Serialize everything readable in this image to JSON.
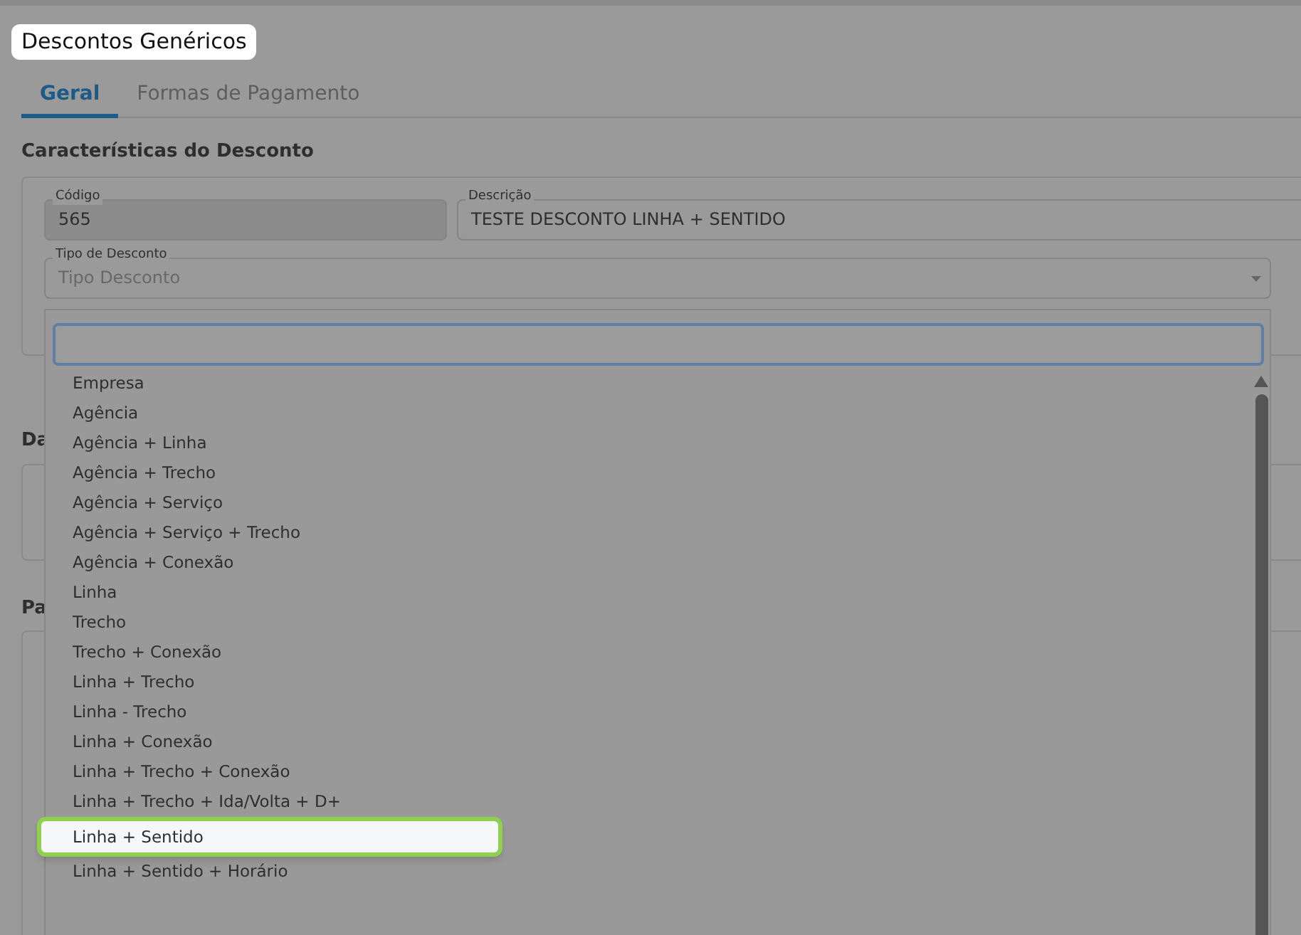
{
  "page": {
    "title": "Descontos Genéricos"
  },
  "tabs": [
    {
      "label": "Geral",
      "selected": true
    },
    {
      "label": "Formas de Pagamento",
      "selected": false
    }
  ],
  "sections": [
    {
      "heading": "Características do Desconto"
    },
    {
      "heading": "Da"
    },
    {
      "heading": "Pa"
    }
  ],
  "fields": [
    {
      "label": "Código",
      "value": "565",
      "disabled": true
    },
    {
      "label": "Descrição",
      "value": "TESTE DESCONTO LINHA + SENTIDO",
      "disabled": false
    }
  ],
  "dropdown": {
    "label": "Tipo de Desconto",
    "placeholder": "Tipo Desconto",
    "expanded": true,
    "options": [
      {
        "label": "Empresa",
        "selected": false
      },
      {
        "label": "Agência",
        "selected": false
      },
      {
        "label": "Agência + Linha",
        "selected": false
      },
      {
        "label": "Agência + Trecho",
        "selected": false
      },
      {
        "label": "Agência + Serviço",
        "selected": false
      },
      {
        "label": "Agência + Serviço + Trecho",
        "selected": false
      },
      {
        "label": "Agência + Conexão",
        "selected": false
      },
      {
        "label": "Linha",
        "selected": false
      },
      {
        "label": "Trecho",
        "selected": false
      },
      {
        "label": "Trecho + Conexão",
        "selected": false
      },
      {
        "label": "Linha + Trecho",
        "selected": false
      },
      {
        "label": "Linha - Trecho",
        "selected": false
      },
      {
        "label": "Linha + Conexão",
        "selected": false
      },
      {
        "label": "Linha + Trecho + Conexão",
        "selected": false
      },
      {
        "label": "Linha + Trecho + Ida/Volta + D+",
        "selected": false
      },
      {
        "label": "Linha + Sentido",
        "selected": true
      },
      {
        "label": "Linha + Sentido + Horário",
        "selected": false
      }
    ]
  }
}
